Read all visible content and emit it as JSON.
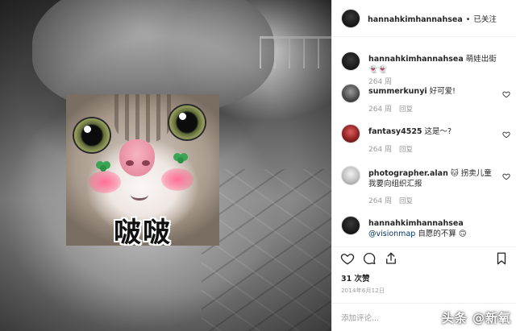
{
  "post": {
    "username": "hannahkimhannahsea",
    "separator": "•",
    "follow_status": "已关注",
    "sticker_caption": "啵啵"
  },
  "comments": [
    {
      "username": "hannahkimhannahsea",
      "text": "萌娃出街 👻👻",
      "mention": "",
      "age": "264 周",
      "reply": ""
    },
    {
      "username": "summerkunyi",
      "text": "好可爱!",
      "mention": "",
      "age": "264 周",
      "reply": "回复"
    },
    {
      "username": "fantasy4525",
      "text": "这是～?",
      "mention": "",
      "age": "264 周",
      "reply": "回复"
    },
    {
      "username": "photographer.alan",
      "text": "🐱 拐卖儿童 我要向组织汇报",
      "mention": "",
      "age": "264 周",
      "reply": "回复"
    },
    {
      "username": "hannahkimhannahsea",
      "text": "自愿的不算 🙃",
      "mention": "@visionmap",
      "age": "",
      "reply": ""
    }
  ],
  "actions": {
    "like_icon": "heart-icon",
    "comment_icon": "comment-bubble-icon",
    "share_icon": "share-icon",
    "save_icon": "bookmark-icon"
  },
  "likes": "31 次赞",
  "date": "2014年6月12日",
  "add_comment_placeholder": "添加评论...",
  "watermark": "头条 @新氧",
  "colors": {
    "text": "#262626",
    "muted": "#999999",
    "mention": "#003569",
    "divider": "#efefef"
  }
}
